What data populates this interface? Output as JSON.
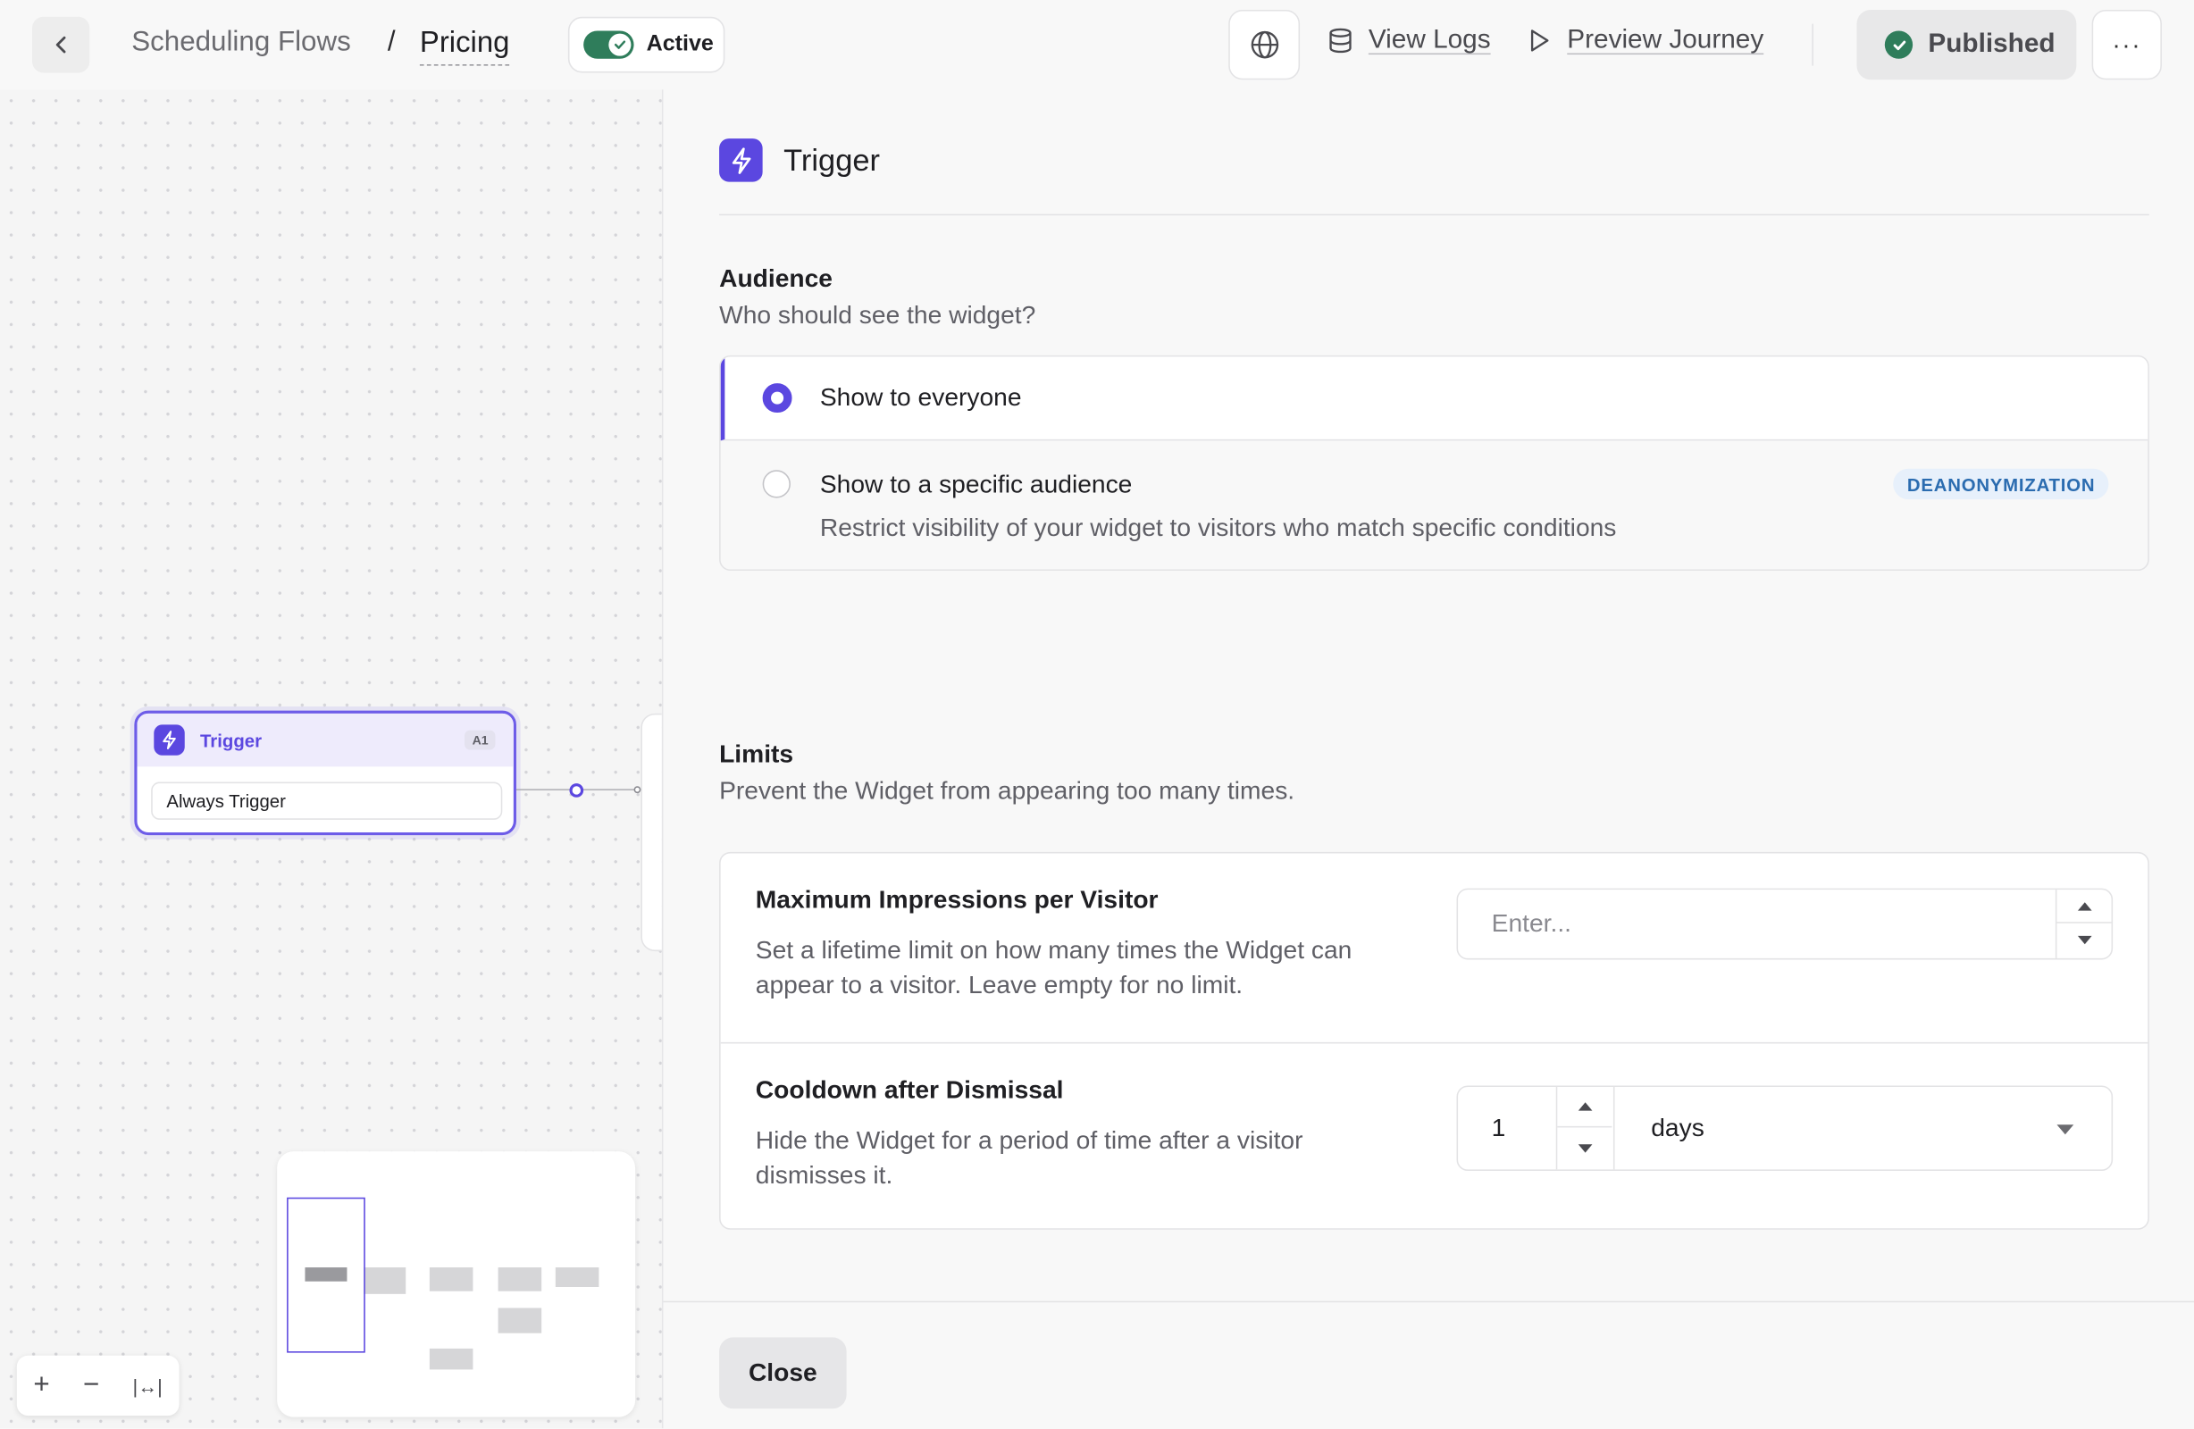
{
  "header": {
    "breadcrumb_parent": "Scheduling Flows",
    "breadcrumb_separator": "/",
    "breadcrumb_current": "Pricing",
    "status_toggle_label": "Active",
    "view_logs_label": "View Logs",
    "preview_journey_label": "Preview Journey",
    "published_label": "Published",
    "more_label": "···"
  },
  "canvas": {
    "node": {
      "title": "Trigger",
      "badge": "A1",
      "body": "Always Trigger"
    },
    "zoom": {
      "zoom_in": "+",
      "zoom_out": "−",
      "fit": "|↔|"
    }
  },
  "panel": {
    "title": "Trigger",
    "audience": {
      "title": "Audience",
      "subtitle": "Who should see the widget?",
      "options": [
        {
          "label": "Show to everyone",
          "selected": true
        },
        {
          "label": "Show to a specific audience",
          "description": "Restrict visibility of your widget to visitors who match specific conditions",
          "tag": "DEANONYMIZATION",
          "selected": false
        }
      ]
    },
    "limits": {
      "title": "Limits",
      "subtitle": "Prevent the Widget from appearing too many times.",
      "max_impressions": {
        "title": "Maximum Impressions per Visitor",
        "description": "Set a lifetime limit on how many times the Widget can appear to a visitor. Leave empty for no limit.",
        "placeholder": "Enter..."
      },
      "cooldown": {
        "title": "Cooldown after Dismissal",
        "description": "Hide the Widget for a period of time after a visitor dismisses it.",
        "value": "1",
        "unit": "days"
      }
    },
    "close_label": "Close"
  },
  "colors": {
    "accent": "#5b47e0",
    "success": "#2f7d5b",
    "tag_text": "#2b6cb0",
    "tag_bg": "#e7f0fb"
  },
  "icons": [
    "chevron-left-icon",
    "check-icon",
    "globe-icon",
    "database-icon",
    "play-icon",
    "check-circle-icon",
    "lightning-icon",
    "plus-icon",
    "minus-icon",
    "fit-width-icon"
  ]
}
